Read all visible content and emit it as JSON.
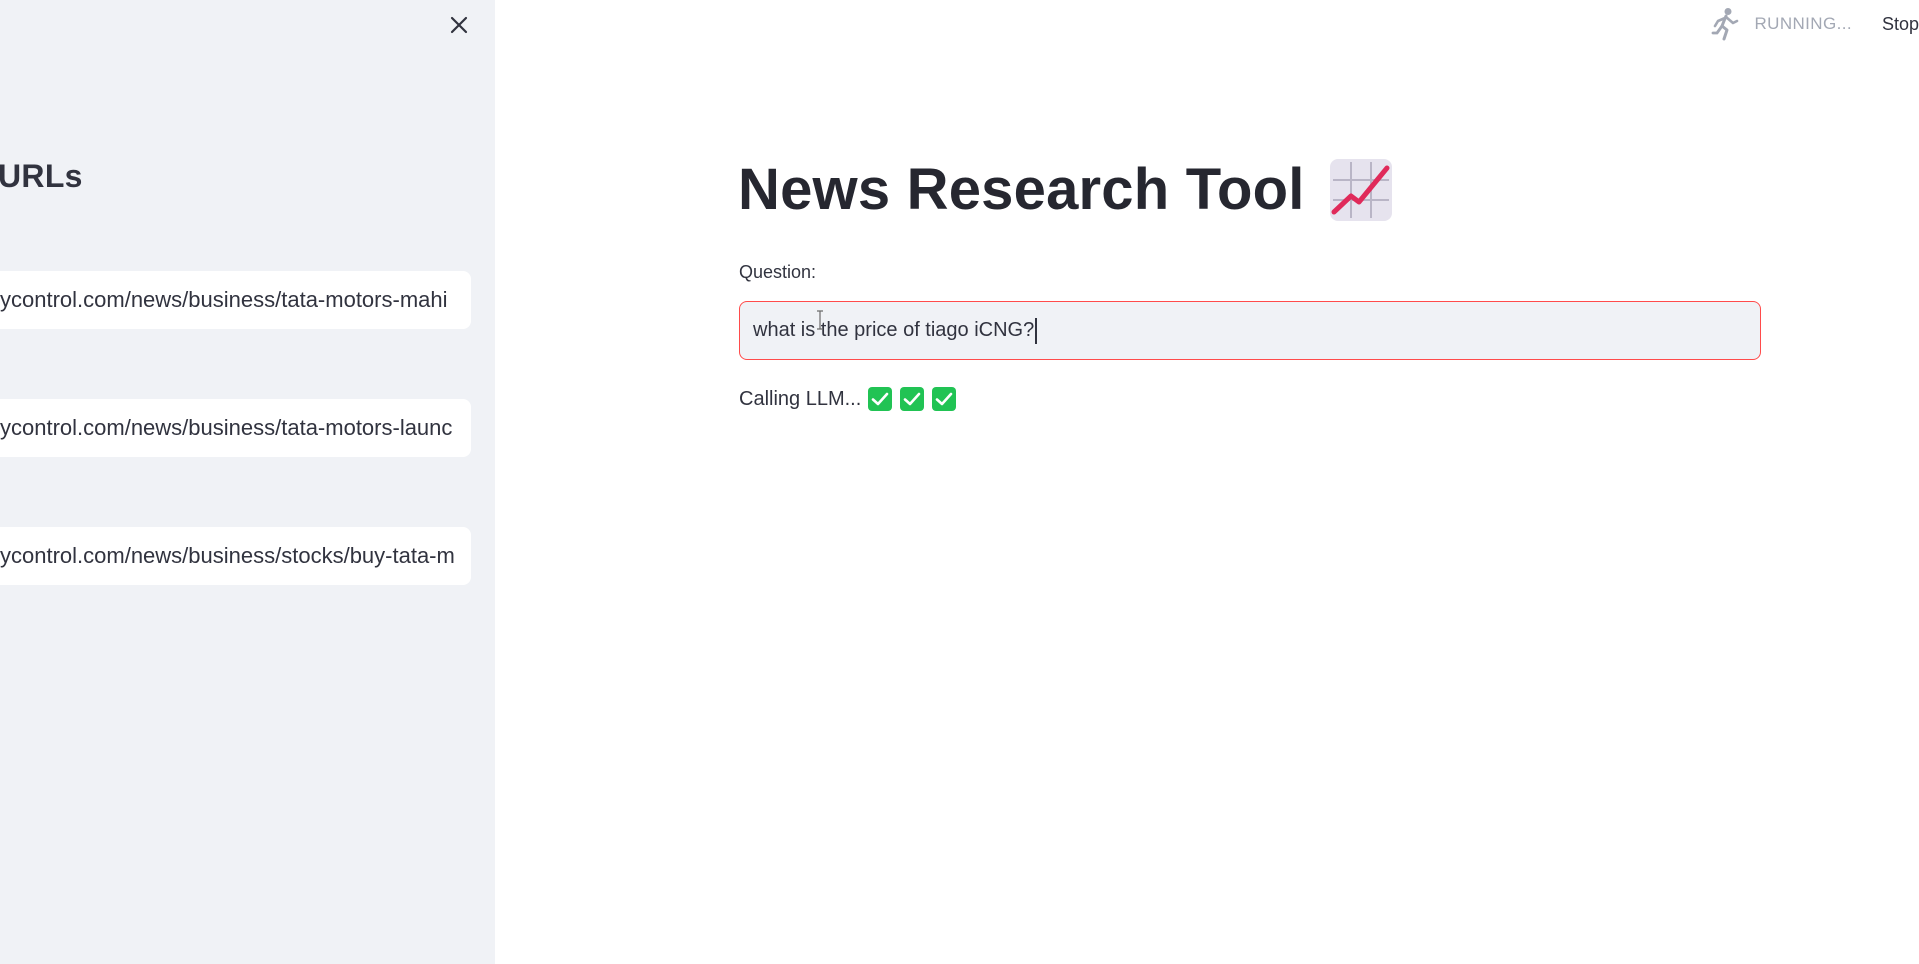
{
  "sidebar": {
    "title": "URLs",
    "close_icon": "close-icon",
    "url_inputs": [
      {
        "value": "ycontrol.com/news/business/tata-motors-mahi"
      },
      {
        "value": "ycontrol.com/news/business/tata-motors-launc"
      },
      {
        "value": "ycontrol.com/news/business/stocks/buy-tata-m"
      }
    ]
  },
  "header": {
    "status_icon": "running-man-icon",
    "status_text": "RUNNING...",
    "stop_label": "Stop"
  },
  "main": {
    "title": "News Research Tool",
    "title_icon": "chart-increasing-icon",
    "question_label": "Question:",
    "question_value": "what is the price of tiago iCNG?",
    "status_text": "Calling LLM...",
    "status_checks": 3
  },
  "colors": {
    "sidebar_bg": "#f0f2f6",
    "accent_red": "#ff4b4b",
    "check_green": "#21c354"
  }
}
